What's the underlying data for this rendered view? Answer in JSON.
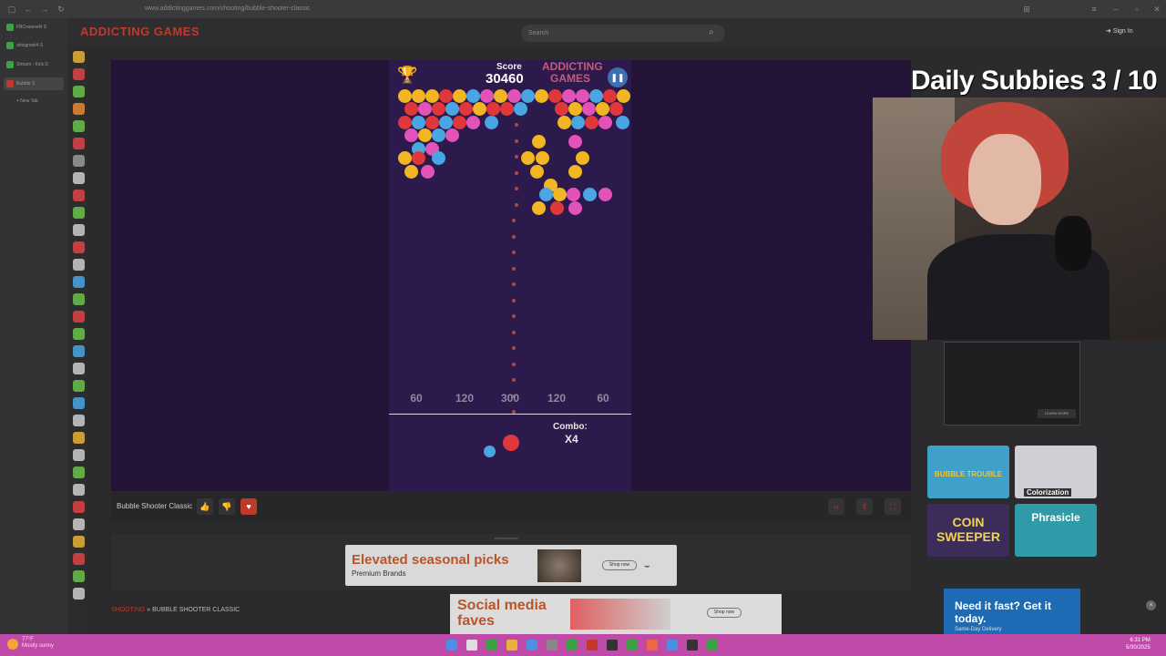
{
  "browser": {
    "url": "www.addictinggames.com/shooting/bubble-shooter-classic",
    "tabs": [
      {
        "label": "FBCnsieneN S",
        "color": "#3aa344"
      },
      {
        "label": "ahtsgrosk4 S",
        "color": "#3aa344"
      },
      {
        "label": "Stream - Kick D",
        "color": "#3aa344"
      },
      {
        "label": "Bubble S",
        "color": "#c0392b"
      },
      {
        "label": "+ New Tab",
        "color": "transparent"
      }
    ]
  },
  "header": {
    "logo": "ADDICTING GAMES",
    "search_placeholder": "Search",
    "sign_in": "Sign In"
  },
  "game": {
    "score_label": "Score",
    "score_value": "30460",
    "logo_line1": "ADDICTING",
    "logo_line2": "GAMES",
    "pause_icon": "pause-icon",
    "buckets": [
      "60",
      "120",
      "300",
      "120",
      "60"
    ],
    "combo_label": "Combo:",
    "combo_value": "X4",
    "colors": {
      "red": "#e0383a",
      "yellow": "#f2b623",
      "blue": "#4aa6e2",
      "pink": "#e252b8"
    }
  },
  "game_bar": {
    "title": "Bubble Shooter Classic"
  },
  "ads": {
    "label": "Advertisement",
    "ad1_title": "Elevated seasonal picks",
    "ad1_sub": "Premium Brands",
    "ad1_shop": "Shop now",
    "ad2_title": "Social media faves",
    "ad2_shop": "Shop now",
    "ad3_title": "Need it fast? Get it today.",
    "ad3_sub": "Same-Day Delivery",
    "learn_more": "LEARN MORE"
  },
  "breadcrumb": {
    "category": "SHOOTING",
    "separator": " » ",
    "page": "BUBBLE SHOOTER CLASSIC"
  },
  "related_games": [
    {
      "label": "BUBBLE TROUBLE",
      "color": "#3fa0c8"
    },
    {
      "label": "Colorization",
      "color": "#cfcfd6"
    },
    {
      "label": "COIN SWEEPER",
      "color": "#3b2c5a"
    },
    {
      "label": "Phrasicle",
      "color": "#2f9aa8"
    }
  ],
  "overlay": {
    "title": "Daily Subbies 3 / 10"
  },
  "taskbar": {
    "weather_temp": "77°F",
    "weather_desc": "Mostly sunny",
    "time": "6:31 PM",
    "date": "5/30/2025"
  }
}
